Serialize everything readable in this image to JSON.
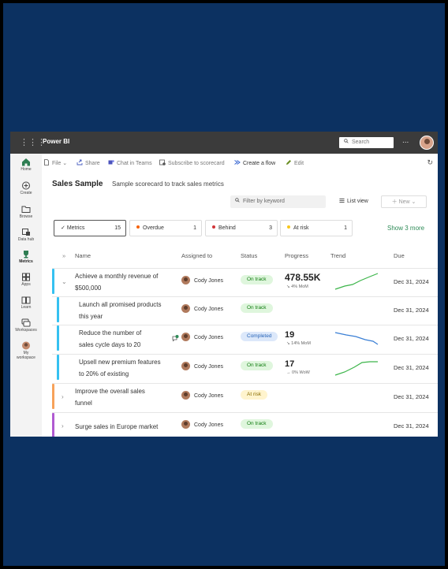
{
  "app": {
    "brand": "Power BI",
    "search_placeholder": "Search",
    "more": "..."
  },
  "rail": [
    {
      "label": "Home",
      "icon": "home-icon"
    },
    {
      "label": "Create",
      "icon": "plus-circle-icon"
    },
    {
      "label": "Browse",
      "icon": "folder-icon"
    },
    {
      "label": "Data hub",
      "icon": "data-hub-icon"
    },
    {
      "label": "Metrics",
      "icon": "trophy-icon"
    },
    {
      "label": "Apps",
      "icon": "apps-icon"
    },
    {
      "label": "Learn",
      "icon": "book-icon"
    },
    {
      "label": "Workspaces",
      "icon": "workspaces-icon"
    },
    {
      "label": "My workspace",
      "icon": "my-workspace-icon"
    }
  ],
  "commands": {
    "file": "File",
    "share": "Share",
    "chat": "Chat in Teams",
    "subscribe": "Subscribe to scorecard",
    "create_flow": "Create a flow",
    "edit": "Edit"
  },
  "scorecard": {
    "title": "Sales Sample",
    "subtitle": "Sample scorecard to track sales metrics",
    "filter_placeholder": "Filter by keyword",
    "list_view": "List view",
    "new": "New"
  },
  "pills": [
    {
      "label": "Metrics",
      "count": "15"
    },
    {
      "label": "Overdue",
      "count": "1"
    },
    {
      "label": "Behind",
      "count": "3"
    },
    {
      "label": "At risk",
      "count": "1"
    }
  ],
  "show_more": "Show 3 more",
  "columns": {
    "name": "Name",
    "assigned": "Assigned to",
    "status": "Status",
    "progress": "Progress",
    "trend": "Trend",
    "due": "Due"
  },
  "rows": [
    {
      "name": "Achieve a monthly revenue of $500,000",
      "assigned": "Cody Jones",
      "status": "On track",
      "progress": "478.55K",
      "progress_sub": "↘ 4% MoM",
      "due": "Dec 31, 2024"
    },
    {
      "name": "Launch all promised products this year",
      "assigned": "Cody Jones",
      "status": "On track",
      "progress": "",
      "progress_sub": "",
      "due": "Dec 31, 2024"
    },
    {
      "name": "Reduce the number of sales cycle days to 20",
      "assigned": "Cody Jones",
      "status": "Completed",
      "progress": "19",
      "progress_sub": "↘ 14% MoM",
      "due": "Dec 31, 2024",
      "comments": "1"
    },
    {
      "name": "Upsell new premium features to 20% of existing",
      "assigned": "Cody Jones",
      "status": "On track",
      "progress": "17",
      "progress_sub": "→ 0% WoW",
      "due": "Dec 31, 2024"
    },
    {
      "name": "Improve the overall sales funnel",
      "assigned": "Cody Jones",
      "status": "At risk",
      "progress": "",
      "progress_sub": "",
      "due": "Dec 31, 2024"
    },
    {
      "name": "Surge sales in Europe market",
      "assigned": "Cody Jones",
      "status": "On track",
      "progress": "",
      "progress_sub": "",
      "due": "Dec 31, 2024"
    }
  ],
  "colors": {
    "frame": "#0c3161",
    "on_track_bg": "#dff6dd",
    "on_track_fg": "#107c10",
    "completed_bg": "#dce8fa",
    "completed_fg": "#2764b8",
    "at_risk_bg": "#fff4ce",
    "at_risk_fg": "#8a6d00",
    "overdue": "#f7630c",
    "behind": "#d13438",
    "at_risk": "#f8c619"
  }
}
